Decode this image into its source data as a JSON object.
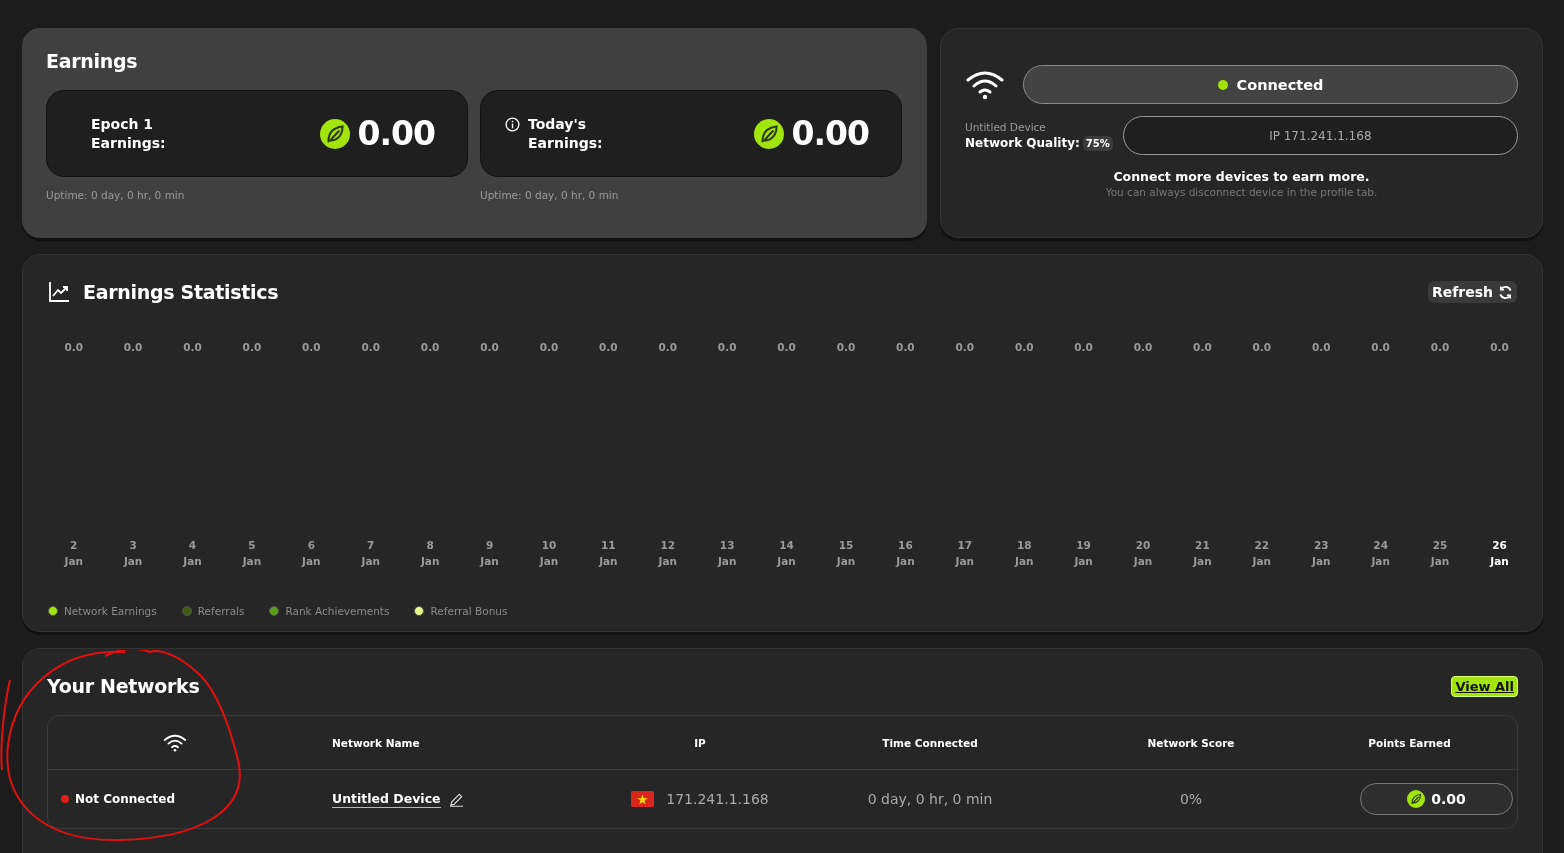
{
  "earnings": {
    "title": "Earnings",
    "cards": [
      {
        "label": "Epoch 1 Earnings:",
        "info": false,
        "amount": "0.00",
        "uptime": "Uptime: 0 day, 0 hr, 0 min"
      },
      {
        "label": "Today's Earnings:",
        "info": true,
        "amount": "0.00",
        "uptime": "Uptime: 0 day, 0 hr, 0 min"
      }
    ]
  },
  "device": {
    "status": "Connected",
    "connected": true,
    "name": "Untitled Device",
    "quality_label": "Network Quality:",
    "quality": "75%",
    "ip": "IP 171.241.1.168",
    "message": "Connect more devices to earn more.",
    "hint": "You can always disconnect device in the profile tab."
  },
  "statistics": {
    "title": "Earnings Statistics",
    "refresh": "Refresh",
    "days": [
      {
        "value": "0.0",
        "day": "2",
        "month": "Jan",
        "selected": false
      },
      {
        "value": "0.0",
        "day": "3",
        "month": "Jan",
        "selected": false
      },
      {
        "value": "0.0",
        "day": "4",
        "month": "Jan",
        "selected": false
      },
      {
        "value": "0.0",
        "day": "5",
        "month": "Jan",
        "selected": false
      },
      {
        "value": "0.0",
        "day": "6",
        "month": "Jan",
        "selected": false
      },
      {
        "value": "0.0",
        "day": "7",
        "month": "Jan",
        "selected": false
      },
      {
        "value": "0.0",
        "day": "8",
        "month": "Jan",
        "selected": false
      },
      {
        "value": "0.0",
        "day": "9",
        "month": "Jan",
        "selected": false
      },
      {
        "value": "0.0",
        "day": "10",
        "month": "Jan",
        "selected": false
      },
      {
        "value": "0.0",
        "day": "11",
        "month": "Jan",
        "selected": false
      },
      {
        "value": "0.0",
        "day": "12",
        "month": "Jan",
        "selected": false
      },
      {
        "value": "0.0",
        "day": "13",
        "month": "Jan",
        "selected": false
      },
      {
        "value": "0.0",
        "day": "14",
        "month": "Jan",
        "selected": false
      },
      {
        "value": "0.0",
        "day": "15",
        "month": "Jan",
        "selected": false
      },
      {
        "value": "0.0",
        "day": "16",
        "month": "Jan",
        "selected": false
      },
      {
        "value": "0.0",
        "day": "17",
        "month": "Jan",
        "selected": false
      },
      {
        "value": "0.0",
        "day": "18",
        "month": "Jan",
        "selected": false
      },
      {
        "value": "0.0",
        "day": "19",
        "month": "Jan",
        "selected": false
      },
      {
        "value": "0.0",
        "day": "20",
        "month": "Jan",
        "selected": false
      },
      {
        "value": "0.0",
        "day": "21",
        "month": "Jan",
        "selected": false
      },
      {
        "value": "0.0",
        "day": "22",
        "month": "Jan",
        "selected": false
      },
      {
        "value": "0.0",
        "day": "23",
        "month": "Jan",
        "selected": false
      },
      {
        "value": "0.0",
        "day": "24",
        "month": "Jan",
        "selected": false
      },
      {
        "value": "0.0",
        "day": "25",
        "month": "Jan",
        "selected": false
      },
      {
        "value": "0.0",
        "day": "26",
        "month": "Jan",
        "selected": true
      }
    ],
    "legend": [
      {
        "name": "Network Earnings",
        "color": "#a3e40c"
      },
      {
        "name": "Referrals",
        "color": "#3f5a10"
      },
      {
        "name": "Rank Achievements",
        "color": "#5a9e1a"
      },
      {
        "name": "Referral Bonus",
        "color": "#e6f98a"
      }
    ]
  },
  "networks": {
    "title": "Your Networks",
    "view_all": "View All",
    "columns": [
      "Network Name",
      "IP",
      "Time Connected",
      "Network Score",
      "Points Earned"
    ],
    "rows": [
      {
        "status": "Not Connected",
        "connected": false,
        "name": "Untitled Device",
        "ip": "171.241.1.168",
        "time": "0 day, 0 hr, 0 min",
        "score": "0%",
        "points": "0.00"
      }
    ]
  }
}
